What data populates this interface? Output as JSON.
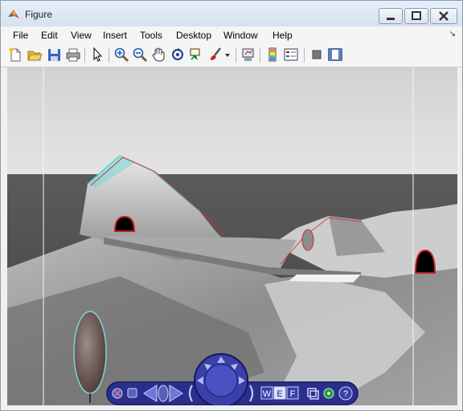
{
  "window": {
    "title": "Figure"
  },
  "menu": [
    "File",
    "Edit",
    "View",
    "Insert",
    "Tools",
    "Desktop",
    "Window",
    "Help"
  ],
  "nav_widget": {
    "w_label": "W",
    "e_label": "E",
    "f_label": "F",
    "help_label": "?"
  }
}
